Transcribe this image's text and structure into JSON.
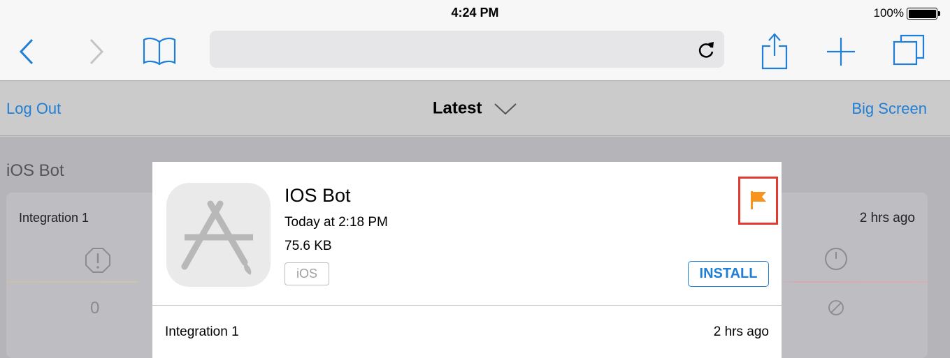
{
  "status_bar": {
    "time": "4:24 PM",
    "battery_percent": "100%"
  },
  "browser": {
    "address": ""
  },
  "nav": {
    "left_link": "Log Out",
    "title": "Latest",
    "right_link": "Big Screen"
  },
  "background": {
    "section_title": "iOS Bot",
    "card_label": "Integration 1",
    "card_time": "2 hrs ago",
    "card_count": "0"
  },
  "modal": {
    "app_name": "IOS Bot",
    "date": "Today at 2:18 PM",
    "size": "75.6 KB",
    "platform": "iOS",
    "install_label": "INSTALL",
    "integration_label": "Integration 1",
    "integration_time": "2 hrs ago",
    "flag_color": "#f7941d"
  },
  "colors": {
    "accent": "#1f7fd6",
    "highlight": "#e33a2f",
    "flag": "#f7941d"
  }
}
